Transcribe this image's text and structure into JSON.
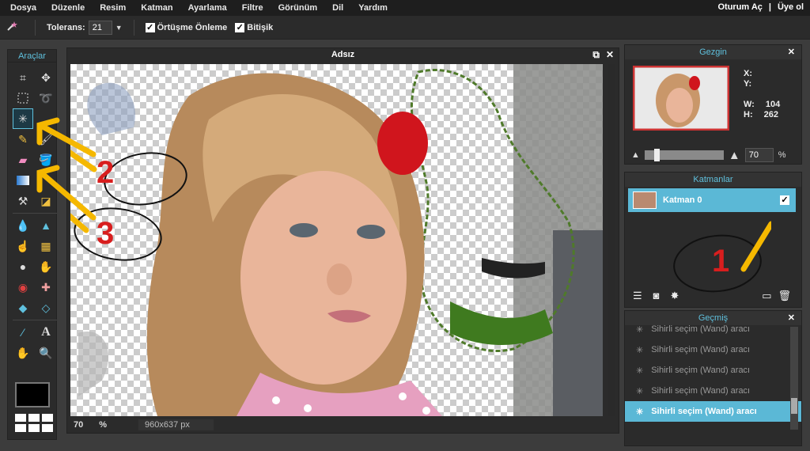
{
  "menu": {
    "items": [
      "Dosya",
      "Düzenle",
      "Resim",
      "Katman",
      "Ayarlama",
      "Filtre",
      "Görünüm",
      "Dil",
      "Yardım"
    ],
    "login": "Oturum Aç",
    "separator": "|",
    "signup": "Üye ol"
  },
  "options": {
    "tolerance_label": "Tolerans:",
    "tolerance_value": "21",
    "antialias_label": "Örtüşme Önleme",
    "contiguous_label": "Bitişik",
    "check": "✓"
  },
  "tools": {
    "title": "Araçlar"
  },
  "canvas": {
    "title": "Adsız",
    "zoom": "70",
    "pct": "%",
    "size": "960x637 px"
  },
  "navigator": {
    "title": "Gezgin",
    "x_label": "X:",
    "y_label": "Y:",
    "w_label": "W:",
    "w_value": "104",
    "h_label": "H:",
    "h_value": "262",
    "zoom_value": "70",
    "zoom_unit": "%"
  },
  "layers": {
    "title": "Katmanlar",
    "items": [
      {
        "name": "Katman 0",
        "visible": true
      }
    ]
  },
  "history": {
    "title": "Geçmiş",
    "items": [
      {
        "label": "Sihirli seçim (Wand) aracı",
        "active": false
      },
      {
        "label": "Sihirli seçim (Wand) aracı",
        "active": false
      },
      {
        "label": "Sihirli seçim (Wand) aracı",
        "active": false
      },
      {
        "label": "Sihirli seçim (Wand) aracı",
        "active": false
      },
      {
        "label": "Sihirli seçim (Wand) aracı",
        "active": true
      }
    ]
  },
  "annotations": [
    "1",
    "2",
    "3"
  ],
  "colors": {
    "accent": "#5bb8d6",
    "annotation": "#d81e1e",
    "arrow": "#f5b800"
  }
}
